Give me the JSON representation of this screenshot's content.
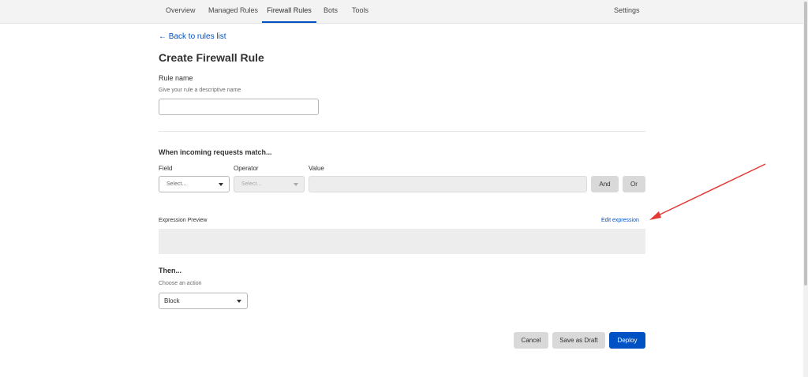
{
  "nav": {
    "tabs": [
      {
        "label": "Overview"
      },
      {
        "label": "Managed Rules"
      },
      {
        "label": "Firewall Rules"
      },
      {
        "label": "Bots"
      },
      {
        "label": "Tools"
      }
    ],
    "settings": "Settings",
    "active_tab": "Firewall Rules"
  },
  "page": {
    "back_link": "← Back to rules list",
    "title": "Create Firewall Rule"
  },
  "rule_name": {
    "label": "Rule name",
    "help": "Give your rule a descriptive name",
    "value": ""
  },
  "match": {
    "title": "When incoming requests match...",
    "field_label": "Field",
    "operator_label": "Operator",
    "value_label": "Value",
    "field_select": "Select...",
    "operator_select": "Select...",
    "and_button": "And",
    "or_button": "Or"
  },
  "expression": {
    "label": "Expression Preview",
    "edit_link": "Edit expression",
    "value": ""
  },
  "then": {
    "title": "Then...",
    "help": "Choose an action",
    "action_select": "Block"
  },
  "footer": {
    "cancel": "Cancel",
    "save_draft": "Save as Draft",
    "deploy": "Deploy"
  },
  "colors": {
    "accent": "#0051c3",
    "annotation_arrow": "#e53935"
  }
}
